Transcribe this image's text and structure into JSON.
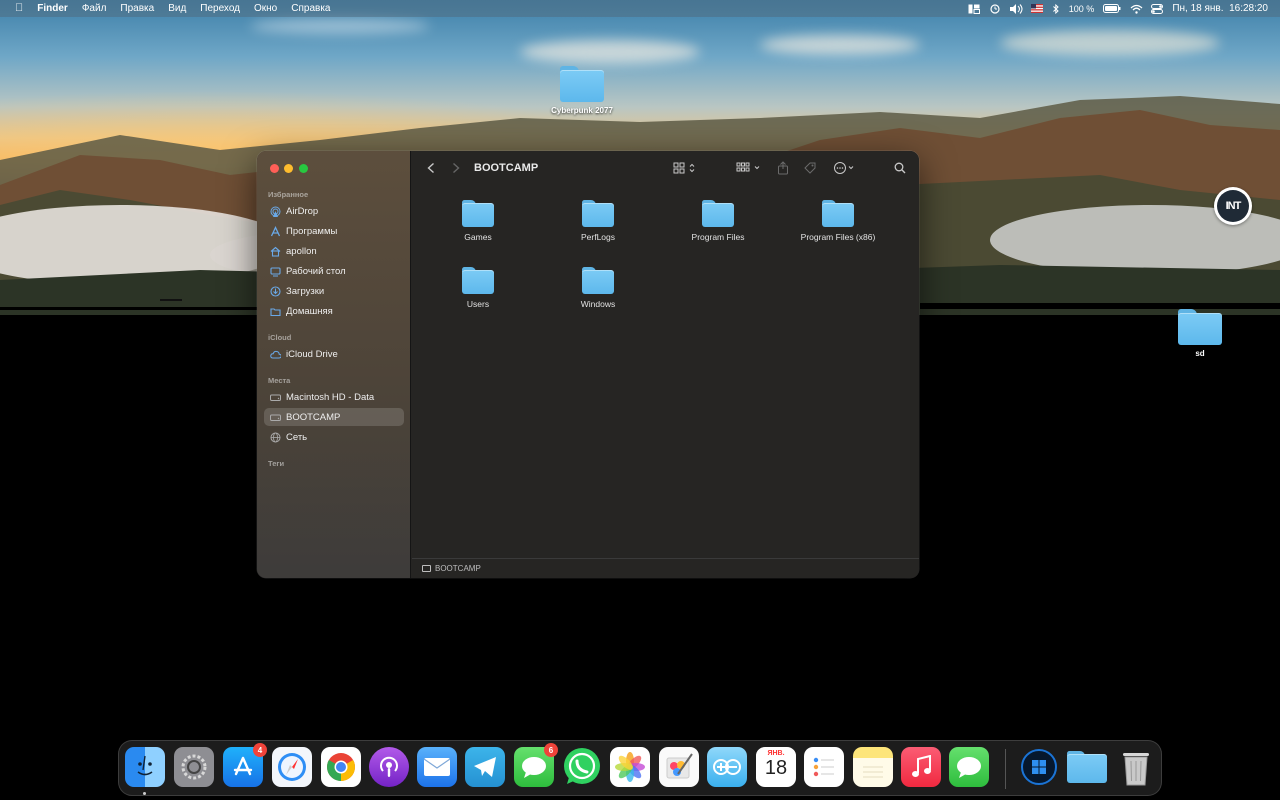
{
  "menubar": {
    "apple_icon": "apple-icon",
    "items": [
      "Finder",
      "Файл",
      "Правка",
      "Вид",
      "Переход",
      "Окно",
      "Справка"
    ],
    "battery": "100 %",
    "datetime": "Пн, 18 янв.  16:28:20"
  },
  "desktop": {
    "items": [
      {
        "label": "Cyberpunk 2077",
        "icon": "folder-icon"
      },
      {
        "label": "sd",
        "icon": "folder-icon"
      }
    ],
    "watermark": "INT"
  },
  "finder": {
    "title": "BOOTCAMP",
    "sidebar": {
      "favorites_header": "Избранное",
      "favorites": [
        {
          "label": "AirDrop",
          "icon": "airdrop-icon"
        },
        {
          "label": "Программы",
          "icon": "applications-icon"
        },
        {
          "label": "apollon",
          "icon": "home-icon"
        },
        {
          "label": "Рабочий стол",
          "icon": "desktop-icon"
        },
        {
          "label": "Загрузки",
          "icon": "downloads-icon"
        },
        {
          "label": "Домашняя",
          "icon": "folder-icon"
        }
      ],
      "icloud_header": "iCloud",
      "icloud": [
        {
          "label": "iCloud Drive",
          "icon": "cloud-icon"
        }
      ],
      "locations_header": "Места",
      "locations": [
        {
          "label": "Macintosh HD - Data",
          "icon": "drive-icon"
        },
        {
          "label": "BOOTCAMP",
          "icon": "drive-icon",
          "selected": true
        },
        {
          "label": "Сеть",
          "icon": "network-icon"
        }
      ],
      "tags_header": "Теги"
    },
    "items": [
      {
        "label": "Games"
      },
      {
        "label": "PerfLogs"
      },
      {
        "label": "Program Files"
      },
      {
        "label": "Program Files (x86)"
      },
      {
        "label": "Users"
      },
      {
        "label": "Windows"
      }
    ],
    "pathbar": "BOOTCAMP"
  },
  "dock": {
    "apps": [
      {
        "name": "Finder",
        "icon": "finder-icon",
        "color": "#3b9af0",
        "running": true
      },
      {
        "name": "System Preferences",
        "icon": "gear-icon",
        "color": "#8e8e93"
      },
      {
        "name": "App Store",
        "icon": "appstore-icon",
        "color": "#1c8ef9",
        "badge": "4"
      },
      {
        "name": "Safari",
        "icon": "safari-icon",
        "color": "#e8f2ff"
      },
      {
        "name": "Chrome",
        "icon": "chrome-icon",
        "color": "#ffffff"
      },
      {
        "name": "Podcasts",
        "icon": "podcasts-icon",
        "color": "#8e3bd8"
      },
      {
        "name": "Mail",
        "icon": "mail-icon",
        "color": "#3a8ef5"
      },
      {
        "name": "Telegram",
        "icon": "telegram-icon",
        "color": "#2ea3e0"
      },
      {
        "name": "Messages",
        "icon": "messages-icon",
        "color": "#3ec94d",
        "badge": "6"
      },
      {
        "name": "WhatsApp",
        "icon": "whatsapp-icon",
        "color": "#2fd160"
      },
      {
        "name": "Photos",
        "icon": "photos-icon",
        "color": "#ffffff"
      },
      {
        "name": "Pixelmator",
        "icon": "pixelmator-icon",
        "color": "#ffffff"
      },
      {
        "name": "Screens",
        "icon": "remote-icon",
        "color": "#5fc3f2"
      },
      {
        "name": "Calendar",
        "icon": "calendar-icon",
        "color": "#ffffff",
        "month": "ЯНВ.",
        "day": "18"
      },
      {
        "name": "Reminders",
        "icon": "reminders-icon",
        "color": "#ffffff"
      },
      {
        "name": "Notes",
        "icon": "notes-icon",
        "color": "#fde57a"
      },
      {
        "name": "Music",
        "icon": "music-icon",
        "color": "#f8384f"
      },
      {
        "name": "Messages 2",
        "icon": "chat-icon",
        "color": "#3ec94d"
      }
    ],
    "stack": [
      {
        "name": "Windows",
        "icon": "windows-icon",
        "color": "#0a4a9c"
      },
      {
        "name": "Folder",
        "icon": "folder-icon",
        "color": "#6ec3f2"
      },
      {
        "name": "Trash",
        "icon": "trash-icon",
        "color": "#c8c8c8"
      }
    ]
  }
}
